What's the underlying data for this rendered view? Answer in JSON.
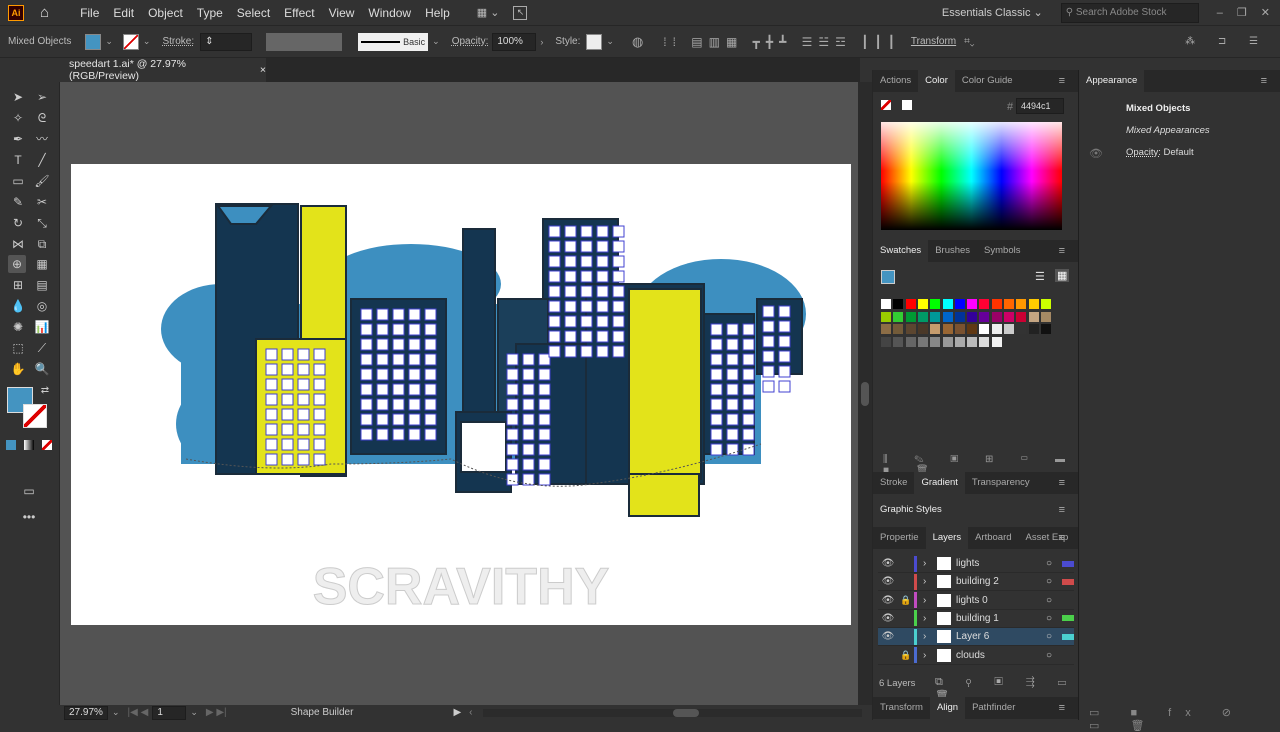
{
  "app": {
    "logo": "Ai",
    "menu": [
      "File",
      "Edit",
      "Object",
      "Type",
      "Select",
      "Effect",
      "View",
      "Window",
      "Help"
    ],
    "workspace": "Essentials Classic",
    "search_placeholder": "Search Adobe Stock"
  },
  "control": {
    "selection": "Mixed Objects",
    "fill_color": "#4494c1",
    "stroke_label": "Stroke:",
    "brush": "Basic",
    "opacity_label": "Opacity:",
    "opacity": "100%",
    "style_label": "Style:",
    "transform_label": "Transform"
  },
  "document": {
    "tab_title": "speedart 1.ai* @ 27.97% (RGB/Preview)",
    "close": "×"
  },
  "color_panel": {
    "tabs": [
      "Actions",
      "Color",
      "Color Guide"
    ],
    "hex_label": "#",
    "hex": "4494c1"
  },
  "swatches_panel": {
    "tabs": [
      "Swatches",
      "Brushes",
      "Symbols"
    ],
    "colors": [
      "#ffffff",
      "#000000",
      "#ff0000",
      "#ffff00",
      "#00ff00",
      "#00ffff",
      "#0000ff",
      "#ff00ff",
      "#ff0033",
      "#ff3300",
      "#ff6600",
      "#ff9900",
      "#ffcc00",
      "#ccff00",
      "#99cc00",
      "#33cc33",
      "#009933",
      "#009966",
      "#009999",
      "#0066cc",
      "#003399",
      "#330099",
      "#660099",
      "#990066",
      "#cc0066",
      "#cc0033",
      "#c4a582",
      "#a68a64",
      "#8c6d46",
      "#735b39",
      "#5c4630",
      "#4a3828",
      "#c69c6d",
      "#996633",
      "#7a5230",
      "#603813",
      "#ffffff",
      "#eeeeee",
      "#cccccc",
      "#333333",
      "#222222",
      "#111111",
      "#444444",
      "#555555",
      "#666666",
      "#777777",
      "#888888",
      "#999999",
      "#aaaaaa",
      "#bbbbbb",
      "#dddddd",
      "#f2f2f2"
    ]
  },
  "lower_tabs": {
    "stroke_group": [
      "Stroke",
      "Gradient",
      "Transparency"
    ],
    "graphic_styles": "Graphic Styles",
    "layers_group": [
      "Propertie",
      "Layers",
      "Artboard",
      "Asset Exp"
    ],
    "bottom_group": [
      "Transform",
      "Align",
      "Pathfinder"
    ]
  },
  "layers": {
    "rows": [
      {
        "name": "lights",
        "color": "#4b4bd0",
        "visible": true,
        "locked": false
      },
      {
        "name": "building 2",
        "color": "#d04b4b",
        "visible": true,
        "locked": false
      },
      {
        "name": "lights 0",
        "color": "#c04bc0",
        "visible": true,
        "locked": true
      },
      {
        "name": "building 1",
        "color": "#4bd04b",
        "visible": true,
        "locked": false
      },
      {
        "name": "Layer 6",
        "color": "#4bd0d0",
        "visible": true,
        "locked": false,
        "selected": true
      },
      {
        "name": "clouds",
        "color": "#4b6bd0",
        "visible": false,
        "locked": true
      }
    ],
    "count": "6 Layers"
  },
  "appearance": {
    "title": "Appearance",
    "heading": "Mixed Objects",
    "sub": "Mixed Appearances",
    "opacity_label": "Opacity:",
    "opacity_value": "Default"
  },
  "status": {
    "zoom": "27.97%",
    "artboard": "1",
    "tool": "Shape Builder"
  },
  "artwork": {
    "watermark": "SCRAVITHY"
  }
}
